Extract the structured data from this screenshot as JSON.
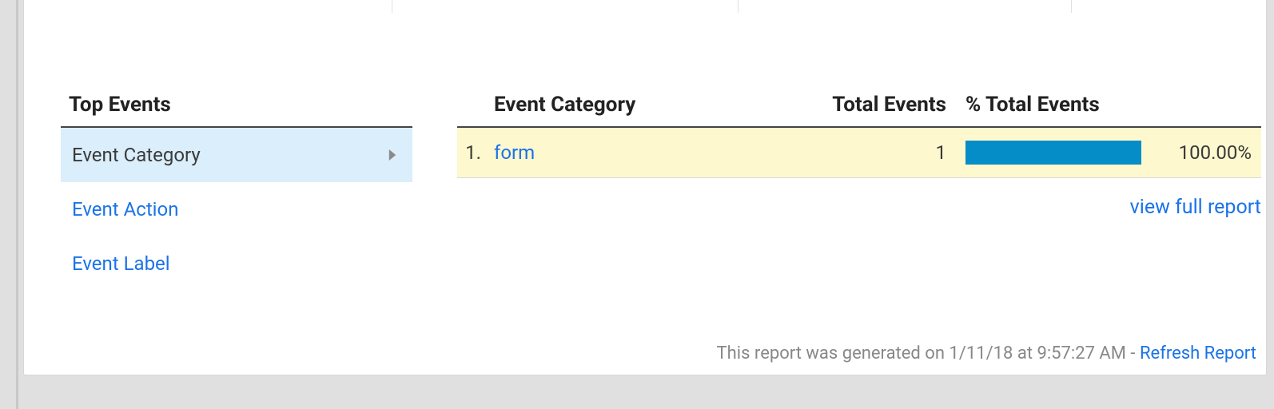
{
  "nav": {
    "header": "Top Events",
    "items": [
      {
        "label": "Event Category",
        "selected": true
      },
      {
        "label": "Event Action",
        "selected": false
      },
      {
        "label": "Event Label",
        "selected": false
      }
    ]
  },
  "table": {
    "columns": {
      "name": "Event Category",
      "total": "Total Events",
      "pct": "% Total Events"
    },
    "rows": [
      {
        "index": "1.",
        "name": "form",
        "total": "1",
        "pct_bar": 100,
        "pct_text": "100.00%"
      }
    ],
    "view_full": "view full report"
  },
  "footer": {
    "generated_prefix": "This report was generated on ",
    "generated_time": "1/11/18 at 9:57:27 AM",
    "sep": " - ",
    "refresh": "Refresh Report"
  }
}
